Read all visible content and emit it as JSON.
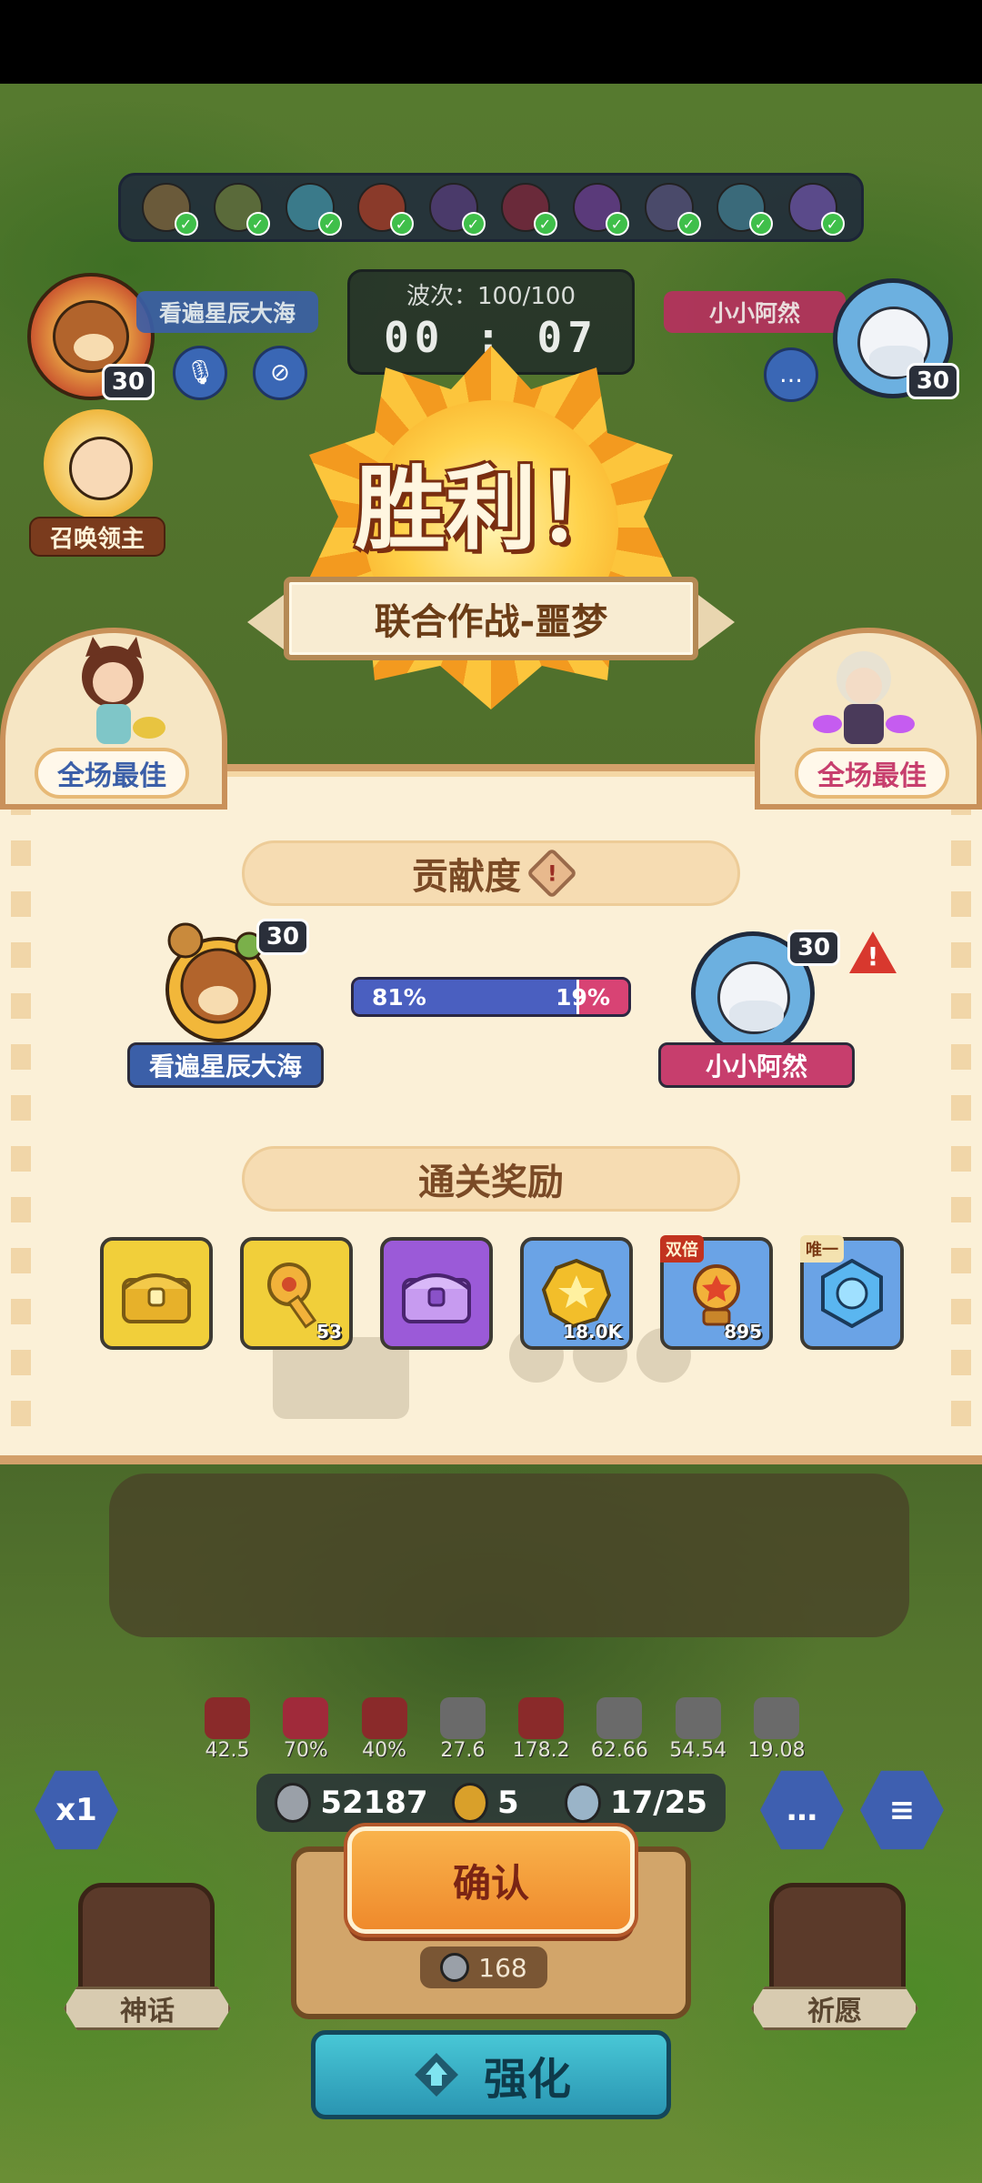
{
  "header": {
    "left_player": {
      "name": "看遍星辰大海",
      "level": "30"
    },
    "right_player": {
      "name": "小小阿然",
      "level": "30"
    },
    "wave_label": "波次：100/100",
    "timer": "00 : 07",
    "summon_label": "召唤领主"
  },
  "victory": {
    "title": "胜利！",
    "stage": "联合作战-噩梦"
  },
  "mvp": {
    "left_label": "全场最佳",
    "right_label": "全场最佳"
  },
  "contribution": {
    "title": "贡献度",
    "info_icon": "!",
    "left": {
      "name": "看遍星辰大海",
      "level": "30",
      "percent_label": "81%",
      "percent": 81
    },
    "right": {
      "name": "小小阿然",
      "level": "30",
      "percent_label": "19%",
      "percent": 19
    },
    "warning_icon": "!"
  },
  "rewards": {
    "title": "通关奖励",
    "items": [
      {
        "icon": "gold-chest-icon",
        "count": "",
        "tag": ""
      },
      {
        "icon": "key-icon",
        "count": "53",
        "tag": ""
      },
      {
        "icon": "purple-chest-icon",
        "count": "",
        "tag": ""
      },
      {
        "icon": "coin-icon",
        "count": "18.0K",
        "tag": ""
      },
      {
        "icon": "trophy-icon",
        "count": "895",
        "tag": "双倍"
      },
      {
        "icon": "gem-icon",
        "count": "",
        "tag": "唯一"
      }
    ]
  },
  "hud": {
    "stats": [
      "42.5",
      "70%",
      "40%",
      "27.6",
      "178.2",
      "62.66",
      "54.54",
      "19.08"
    ],
    "silver": "52187",
    "clover": "5",
    "units": "17/25",
    "speed": "x1",
    "confirm_label": "确认",
    "cost": "168",
    "upgrade_label": "强化",
    "left_card_label": "神话",
    "right_card_label": "祈愿"
  },
  "colors": {
    "panel_bg": "#fbf0d7",
    "left_player": "#3b5fa8",
    "right_player": "#c73e6d",
    "confirm": "#f39c34",
    "upgrade": "#37b1c6"
  }
}
